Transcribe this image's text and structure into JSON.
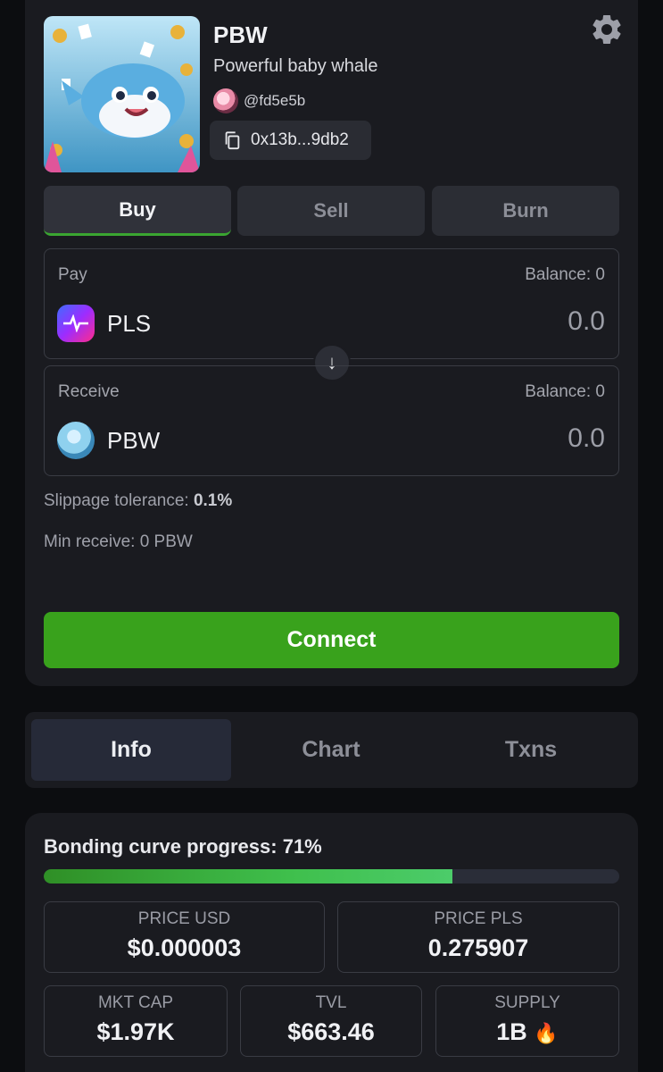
{
  "token": {
    "ticker": "PBW",
    "name": "Powerful baby whale",
    "creator": "@fd5e5b",
    "address": "0x13b...9db2"
  },
  "trade_tabs": [
    {
      "label": "Buy",
      "active": true
    },
    {
      "label": "Sell",
      "active": false
    },
    {
      "label": "Burn",
      "active": false
    }
  ],
  "pay": {
    "label": "Pay",
    "balance": "Balance: 0",
    "token": "PLS",
    "amount": "0.0"
  },
  "receive": {
    "label": "Receive",
    "balance": "Balance: 0",
    "token": "PBW",
    "amount": "0.0"
  },
  "slippage": {
    "label": "Slippage tolerance:",
    "value": "0.1%"
  },
  "min_receive": "Min receive: 0 PBW",
  "connect_label": "Connect",
  "info_tabs": [
    {
      "label": "Info",
      "active": true
    },
    {
      "label": "Chart",
      "active": false
    },
    {
      "label": "Txns",
      "active": false
    }
  ],
  "bonding": {
    "label": "Bonding curve progress: 71%",
    "progress": 0.71
  },
  "stats": {
    "price_usd": {
      "label": "PRICE USD",
      "value": "$0.000003"
    },
    "price_pls": {
      "label": "PRICE PLS",
      "value": "0.275907"
    },
    "mkt_cap": {
      "label": "MKT CAP",
      "value": "$1.97K"
    },
    "tvl": {
      "label": "TVL",
      "value": "$663.46"
    },
    "supply": {
      "label": "SUPPLY",
      "value": "1B"
    }
  },
  "colors": {
    "accent_green": "#39a21c",
    "progress_green": "#3fbf4c",
    "card_bg": "#1a1b20"
  },
  "icons": {
    "copy": "copy-icon",
    "settings": "gear-icon",
    "swap": "arrow-down-icon",
    "supply": "fire-icon"
  }
}
